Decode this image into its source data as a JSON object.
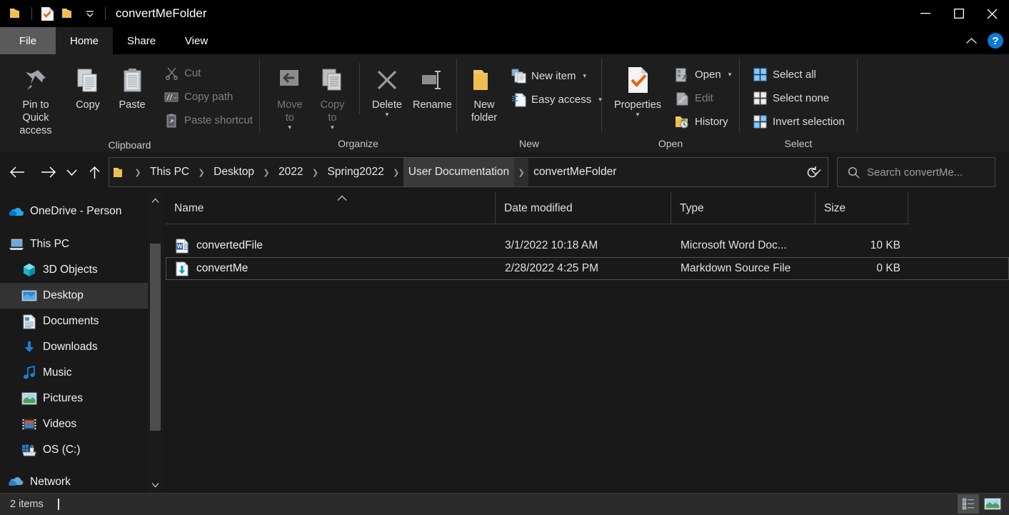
{
  "window": {
    "title": "convertMeFolder",
    "quick_access_icons": [
      "folder-icon",
      "properties-checkmark-icon",
      "new-folder-icon",
      "customize-dropdown-icon"
    ],
    "controls": {
      "minimize": "minimize-icon",
      "maximize": "maximize-icon",
      "close": "close-icon"
    }
  },
  "tabs": [
    {
      "label": "File",
      "state": "hover"
    },
    {
      "label": "Home",
      "state": "active"
    },
    {
      "label": "Share",
      "state": "normal"
    },
    {
      "label": "View",
      "state": "normal"
    }
  ],
  "ribbon_right": {
    "collapse": "chevron-up-icon",
    "help": "?"
  },
  "ribbon": {
    "groups": [
      {
        "name": "Clipboard",
        "label": "Clipboard",
        "big_buttons": [
          {
            "label": "Pin to Quick\naccess",
            "icon": "pin-icon",
            "disabled": false
          },
          {
            "label": "Copy",
            "icon": "copy-icon",
            "disabled": false
          },
          {
            "label": "Paste",
            "icon": "paste-icon",
            "disabled": false
          }
        ],
        "small_buttons": [
          {
            "label": "Cut",
            "icon": "scissors-icon",
            "disabled": true
          },
          {
            "label": "Copy path",
            "icon": "copy-path-icon",
            "disabled": true
          },
          {
            "label": "Paste shortcut",
            "icon": "paste-shortcut-icon",
            "disabled": true
          }
        ]
      },
      {
        "name": "Organize",
        "label": "Organize",
        "big_buttons": [
          {
            "label": "Move\nto",
            "icon": "move-to-icon",
            "disabled": true,
            "caret": true
          },
          {
            "label": "Copy\nto",
            "icon": "copy-to-icon",
            "disabled": true,
            "caret": true
          },
          {
            "label": "Delete",
            "icon": "delete-x-icon",
            "disabled": false,
            "caret": true
          },
          {
            "label": "Rename",
            "icon": "rename-icon",
            "disabled": false
          }
        ]
      },
      {
        "name": "New",
        "label": "New",
        "big_buttons": [
          {
            "label": "New\nfolder",
            "icon": "new-folder-icon",
            "disabled": false
          }
        ],
        "small_buttons": [
          {
            "label": "New item",
            "icon": "new-item-icon",
            "caret": true
          },
          {
            "label": "Easy access",
            "icon": "easy-access-icon",
            "caret": true,
            "disabled": true
          }
        ]
      },
      {
        "name": "Open",
        "label": "Open",
        "big_buttons": [
          {
            "label": "Properties",
            "icon": "properties-checkmark-icon",
            "disabled": false,
            "caret": true
          }
        ],
        "small_buttons": [
          {
            "label": "Open",
            "icon": "open-icon",
            "caret": true
          },
          {
            "label": "Edit",
            "icon": "edit-icon",
            "disabled": true
          },
          {
            "label": "History",
            "icon": "history-icon"
          }
        ]
      },
      {
        "name": "Select",
        "label": "Select",
        "small_buttons": [
          {
            "label": "Select all",
            "icon": "select-all-icon"
          },
          {
            "label": "Select none",
            "icon": "select-none-icon"
          },
          {
            "label": "Invert selection",
            "icon": "invert-selection-icon"
          }
        ]
      }
    ]
  },
  "navigation": {
    "back": "back-arrow-icon",
    "forward": "forward-arrow-icon",
    "recent": "chevron-down-icon",
    "up": "up-arrow-icon",
    "refresh": "refresh-icon"
  },
  "breadcrumb": {
    "folder_icon": "folder-icon",
    "items": [
      {
        "label": "This PC",
        "highlighted": false
      },
      {
        "label": "Desktop",
        "highlighted": false
      },
      {
        "label": "2022",
        "highlighted": false
      },
      {
        "label": "Spring2022",
        "highlighted": false
      },
      {
        "label": "User Documentation",
        "highlighted": true
      },
      {
        "label": "convertMeFolder",
        "highlighted": false
      }
    ],
    "dropdown": "chevron-down-icon"
  },
  "search": {
    "placeholder": "Search convertMe...",
    "icon": "search-icon"
  },
  "sidebar": {
    "items": [
      {
        "label": "OneDrive - Person",
        "icon": "onedrive-icon",
        "level": 0,
        "selected": false
      },
      {
        "label": "This PC",
        "icon": "this-pc-icon",
        "level": 0,
        "selected": false
      },
      {
        "label": "3D Objects",
        "icon": "3d-objects-icon",
        "level": 1,
        "selected": false
      },
      {
        "label": "Desktop",
        "icon": "desktop-icon",
        "level": 1,
        "selected": true
      },
      {
        "label": "Documents",
        "icon": "documents-icon",
        "level": 1,
        "selected": false
      },
      {
        "label": "Downloads",
        "icon": "downloads-icon",
        "level": 1,
        "selected": false
      },
      {
        "label": "Music",
        "icon": "music-icon",
        "level": 1,
        "selected": false
      },
      {
        "label": "Pictures",
        "icon": "pictures-icon",
        "level": 1,
        "selected": false
      },
      {
        "label": "Videos",
        "icon": "videos-icon",
        "level": 1,
        "selected": false
      },
      {
        "label": "OS (C:)",
        "icon": "os-drive-icon",
        "level": 1,
        "selected": false
      },
      {
        "label": "Network",
        "icon": "network-icon",
        "level": 0,
        "selected": false
      }
    ]
  },
  "filelist": {
    "columns": [
      {
        "label": "Name",
        "sorted": "asc"
      },
      {
        "label": "Date modified",
        "sorted": null
      },
      {
        "label": "Type",
        "sorted": null
      },
      {
        "label": "Size",
        "sorted": null
      }
    ],
    "rows": [
      {
        "name": "convertedFile",
        "date_modified": "3/1/2022 10:18 AM",
        "type": "Microsoft Word Doc...",
        "size": "10 KB",
        "icon": "word-document-icon",
        "focused": false
      },
      {
        "name": "convertMe",
        "date_modified": "2/28/2022 4:25 PM",
        "type": "Markdown Source File",
        "size": "0 KB",
        "icon": "markdown-file-icon",
        "focused": true
      }
    ]
  },
  "statusbar": {
    "item_count": "2 items",
    "views": [
      {
        "name": "details-view",
        "active": true
      },
      {
        "name": "large-icons-view",
        "active": false
      }
    ]
  }
}
